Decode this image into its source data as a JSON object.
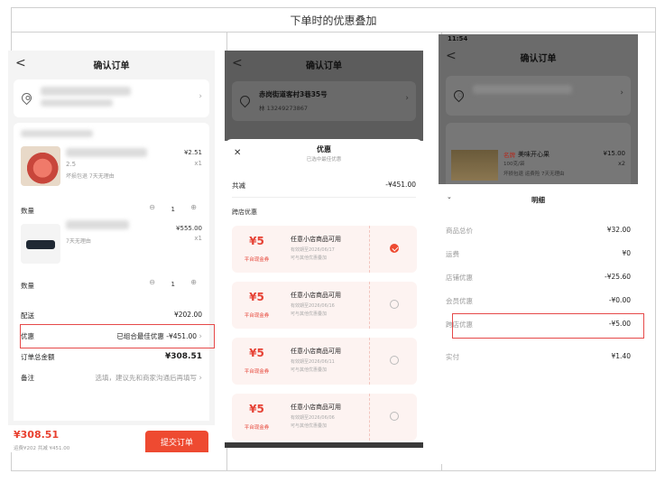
{
  "page_title": "下单时的优惠叠加",
  "panel1": {
    "header": "确认订单",
    "back": "<",
    "item1_price": "¥2.51",
    "item1_qty": "x1",
    "item1_spec": "2.5",
    "item1_tags": "坏损包退 7天无理由",
    "qty_label": "数量",
    "qty_value": "1",
    "item2_price": "¥555.00",
    "item2_qty": "x1",
    "item2_tags": "7天无理由",
    "shipping_label": "配送",
    "shipping_value": "¥202.00",
    "discount_label": "优惠",
    "discount_value": "已组合最佳优惠 -¥451.00",
    "total_label": "订单总金额",
    "total_value": "¥308.51",
    "note_label": "备注",
    "note_placeholder": "选填，建议先和商家沟通后再填写",
    "bottom_total": "¥308.51",
    "bottom_sub": "运费¥202  共减 ¥451.00",
    "submit": "提交订单"
  },
  "panel2": {
    "header": "确认订单",
    "address": "赤岗街道客村3巷35号",
    "phone": "林 13249273867",
    "sheet_title": "优惠",
    "sheet_subtitle": "已选中最佳优惠",
    "close": "✕",
    "total_label": "共减",
    "total_value": "-¥451.00",
    "section": "跨店优惠",
    "coupons": [
      {
        "amount": "¥5",
        "type": "平台现金券",
        "title": "任意小店商品可用",
        "valid": "有效期至2026/06/17",
        "note": "可与其他优惠叠加",
        "selected": true
      },
      {
        "amount": "¥5",
        "type": "平台现金券",
        "title": "任意小店商品可用",
        "valid": "有效期至2026/06/16",
        "note": "可与其他优惠叠加",
        "selected": false
      },
      {
        "amount": "¥5",
        "type": "平台现金券",
        "title": "任意小店商品可用",
        "valid": "有效期至2026/06/11",
        "note": "可与其他优惠叠加",
        "selected": false
      },
      {
        "amount": "¥5",
        "type": "平台现金券",
        "title": "任意小店商品可用",
        "valid": "有效期至2026/06/06",
        "note": "可与其他优惠叠加",
        "selected": false
      }
    ]
  },
  "panel3": {
    "status_time": "11:54",
    "header": "确认订单",
    "product_tag": "名牌",
    "product_name": "美味开心果",
    "product_price": "¥15.00",
    "product_qty": "x2",
    "product_spec": "100克/袋",
    "product_tags": "坏损包退 运费险 7天无理由",
    "sheet_title": "明细",
    "rows": [
      {
        "label": "商品总价",
        "value": "¥32.00"
      },
      {
        "label": "运费",
        "value": "¥0"
      },
      {
        "label": "店铺优惠",
        "value": "-¥25.60"
      },
      {
        "label": "会员优惠",
        "value": "-¥0.00"
      },
      {
        "label": "跨店优惠",
        "value": "-¥5.00"
      },
      {
        "label": "实付",
        "value": "¥1.40"
      }
    ]
  }
}
